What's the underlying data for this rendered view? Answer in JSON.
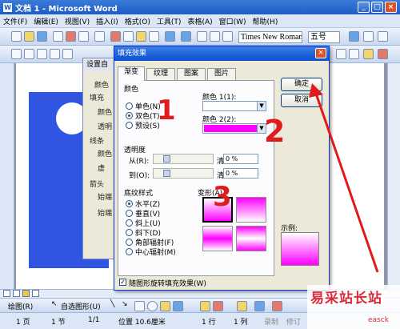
{
  "window": {
    "title": "文档 1 - Microsoft Word"
  },
  "menu": [
    "文件(F)",
    "编辑(E)",
    "视图(V)",
    "插入(I)",
    "格式(O)",
    "工具(T)",
    "表格(A)",
    "窗口(W)",
    "帮助(H)"
  ],
  "toolbar": {
    "font": "Times New Roman",
    "size": "五号"
  },
  "bg_dialog": {
    "title": "设置自",
    "labels": [
      "颜色",
      "填充",
      "颜色",
      "透明",
      "线条",
      "颜色",
      "虚",
      "箭头",
      "始端",
      "始端"
    ]
  },
  "dialog": {
    "title": "填充效果",
    "close": "×",
    "tabs": [
      "渐变",
      "纹理",
      "图案",
      "图片"
    ],
    "colors_group": "颜色",
    "radios": [
      "单色(N)",
      "双色(T)",
      "预设(S)"
    ],
    "color1_label": "颜色 1(1):",
    "color2_label": "颜色 2(2):",
    "transparency_group": "透明度",
    "from_label": "从(R):",
    "to_label": "到(O):",
    "from_value": "0 %",
    "to_value": "0 %",
    "shading_group": "底纹样式",
    "shading_styles": [
      "水平(Z)",
      "垂直(V)",
      "斜上(U)",
      "斜下(D)",
      "角部辐射(F)",
      "中心辐射(M)"
    ],
    "variants_label": "变形(A)",
    "sample_label": "示例:",
    "rotate_checkbox": "随图形旋转填充效果(W)",
    "ok": "确定",
    "cancel": "取消",
    "color2_value": "#ff00ff"
  },
  "annotations": [
    "1",
    "2",
    "3"
  ],
  "drawbar": {
    "draw": "绘图(R)",
    "autoshapes": "自选图形(U)"
  },
  "status": {
    "page": "1 页",
    "section": "1 节",
    "pages": "1/1",
    "position": "位置 10.6厘米",
    "line": "1 行",
    "col": "1 列",
    "rec": "录制",
    "trk": "修订"
  },
  "watermark": {
    "text": "易采站长站",
    "sub": "easck"
  }
}
